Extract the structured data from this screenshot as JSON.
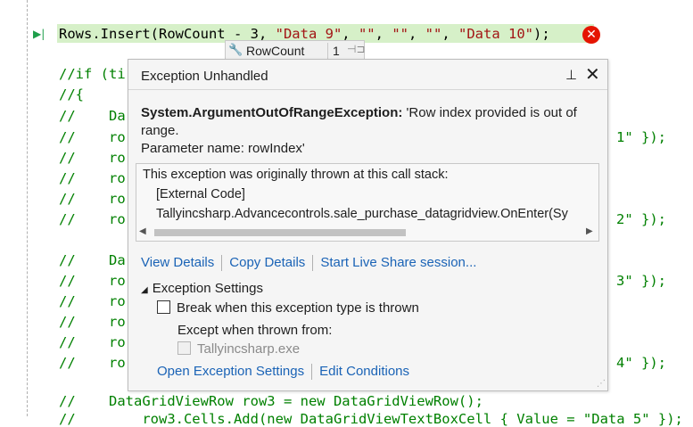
{
  "editor": {
    "exec_line": {
      "prefix": "Rows.Insert(RowCount - 3, ",
      "s1": "\"Data 9\"",
      "sep1": ", ",
      "s2": "\"\"",
      "sep2": ", ",
      "s3": "\"\"",
      "sep3": ", ",
      "s4": "\"\"",
      "sep4": ", ",
      "s5": "\"Data 10\"",
      "suffix": ");"
    },
    "lines": [
      "//if (ti",
      "//{",
      "//    Da",
      "//    ro",
      "//    ro",
      "//    ro",
      "//    ro",
      "//    ro",
      "//    Da",
      "//    ro",
      "//    ro",
      "//    ro",
      "//    ro",
      "//    ro",
      "//    DataGridViewRow row3 = new DataGridViewRow();"
    ],
    "right_fragments": [
      "1\" });",
      "2\" });",
      "3\" });",
      "4\" });"
    ],
    "bottom_partial": "//        row3.Cells.Add(new DataGridViewTextBoxCell { Value = \"Data 5\" });"
  },
  "datatip": {
    "name": "RowCount",
    "value": "1"
  },
  "exception": {
    "title": "Exception Unhandled",
    "type": "System.ArgumentOutOfRangeException:",
    "message": " 'Row index provided is out of range.",
    "param": "Parameter name: rowIndex'",
    "stack_header": "This exception was originally thrown at this call stack:",
    "stack_frames": [
      "[External Code]",
      "Tallyincsharp.Advancecontrols.sale_purchase_datagridview.OnEnter(Sy"
    ],
    "links": [
      "View Details",
      "Copy Details",
      "Start Live Share session..."
    ],
    "settings_title": "Exception Settings",
    "break_label": "Break when this exception type is thrown",
    "except_label": "Except when thrown from:",
    "module_label": "Tallyincsharp.exe",
    "links2": [
      "Open Exception Settings",
      "Edit Conditions"
    ]
  }
}
